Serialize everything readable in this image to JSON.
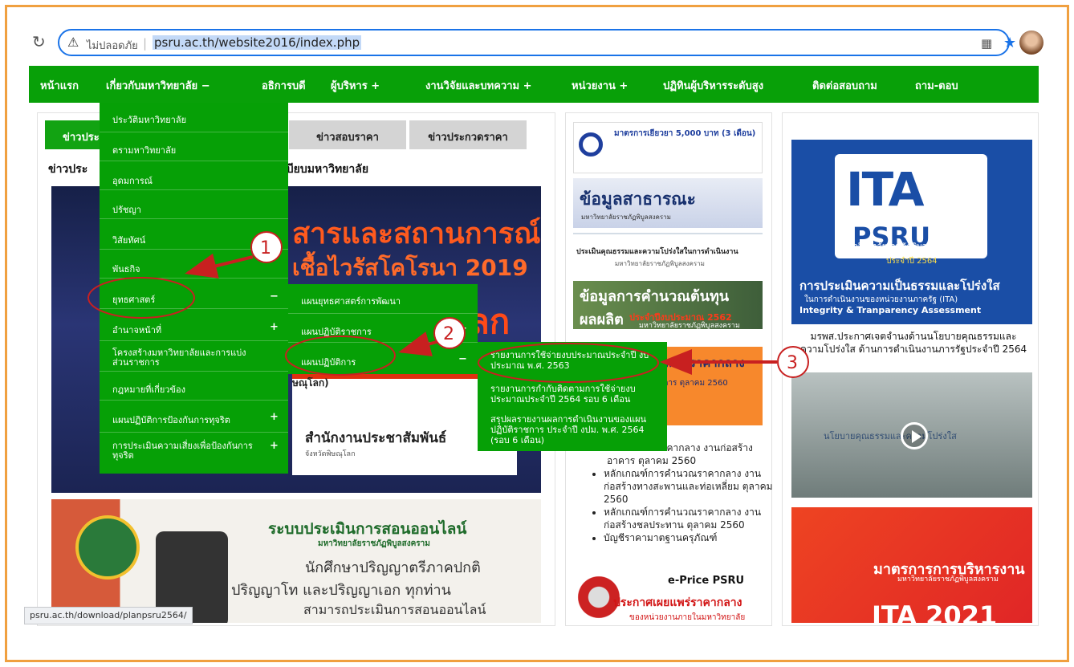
{
  "browser": {
    "not_secure": "ไม่ปลอดภัย",
    "url": "psru.ac.th/website2016/index.php",
    "status_url": "psru.ac.th/download/planpsru2564/"
  },
  "nav": {
    "items": [
      {
        "label": "หน้าแรก"
      },
      {
        "label": "เกี่ยวกับมหาวิทยาลัย  −"
      },
      {
        "label": "อธิการบดี"
      },
      {
        "label": "ผู้บริหาร  +"
      },
      {
        "label": "งานวิจัยและบทความ  +"
      },
      {
        "label": "หน่วยงาน  +"
      },
      {
        "label": "ปฏิทินผู้บริหารระดับสูง"
      },
      {
        "label": "ติดต่อสอบถาม"
      },
      {
        "label": "ถาม-ตอบ"
      }
    ]
  },
  "tabs": {
    "active": "ข่าวประ",
    "t2": "ข่าวสอบราคา",
    "t3": "ข่าวประกวดราคา"
  },
  "news": {
    "heading_left": "ข่าวประ",
    "heading_right": "เบียบมหาวิทยาลัย"
  },
  "banner1": {
    "line1": "สารและสถานการณ์",
    "line2": "เชื้อไวรัสโคโรนา 2019",
    "line3": "ลก",
    "small": "ษณุโลก)",
    "office": "สำนักงานประชาสัมพันธ์",
    "office_sub": "จังหวัดพิษณุโลก"
  },
  "banner2": {
    "title": "ระบบประเมินการสอนออนไลน์",
    "sub": "มหาวิทยาลัยราชภัฏพิบูลสงคราม",
    "l1": "นักศึกษาปริญญาตรีภาคปกติ",
    "l2": "ปริญญาโท และปริญญาเอก ทุกท่าน",
    "l3": "สามารถประเมินการสอนออนไลน์"
  },
  "menu1": {
    "items": [
      {
        "label": "ประวัติมหาวิทยาลัย",
        "sign": ""
      },
      {
        "label": "ตรามหาวิทยาลัย",
        "sign": ""
      },
      {
        "label": "อุดมการณ์",
        "sign": ""
      },
      {
        "label": "ปรัชญา",
        "sign": ""
      },
      {
        "label": "วิสัยทัศน์",
        "sign": ""
      },
      {
        "label": "พันธกิจ",
        "sign": ""
      },
      {
        "label": "ยุทธศาสตร์",
        "sign": "−"
      },
      {
        "label": "อำนาจหน้าที่",
        "sign": "+"
      },
      {
        "label": "โครงสร้างมหาวิทยาลัยและการแบ่ง\nส่วนราชการ",
        "sign": ""
      },
      {
        "label": "กฎหมายที่เกี่ยวข้อง",
        "sign": ""
      },
      {
        "label": "แผนปฏิบัติการป้องกันการทุจริต",
        "sign": "+"
      },
      {
        "label": "การประเมินความเสี่ยงเพื่อป้องกันการ\nทุจริต",
        "sign": "+"
      }
    ]
  },
  "menu2": {
    "items": [
      {
        "label": "แผนยุทธศาสตร์การพัฒนา",
        "sign": ""
      },
      {
        "label": "แผนปฏิบัติราชการ",
        "sign": "+"
      },
      {
        "label": "แผนปฏิบัติการ",
        "sign": "−"
      }
    ]
  },
  "menu3": {
    "items": [
      {
        "label": "รายงานการใช้จ่ายงบประมาณประจำปี งบประมาณ พ.ศ. 2563"
      },
      {
        "label": "รายงานการกำกับติดตามการใช้จ่ายงบประมาณประจำปี 2564 รอบ 6 เดือน"
      },
      {
        "label": "สรุปผลรายงานผลการดำเนินงานของแผนปฏิบัติราชการ ประจำปี งปม. พ.ศ. 2564 (รอบ 6 เดือน)"
      }
    ]
  },
  "annotations": [
    "1",
    "2",
    "3"
  ],
  "middle": {
    "card1_title": "มาตรการเยียวยา 5,000 บาท (3 เดือน)",
    "card2_title": "ข้อมูลสาธารณะ",
    "card2_sub": "มหาวิทยาลัยราชภัฏพิบูลสงคราม",
    "card3_title": "ประเมินคุณธรรมและความโปร่งใสในการดำเนินงาน",
    "card3_sub": "มหาวิทยาลัยราชภัฏพิบูลสงคราม",
    "card4_title": "ข้อมูลการคำนวณต้นทุนผลผลิต",
    "card4_sub": "ประจำปีงบประมาณ 2562",
    "card4_sub2": "มหาวิทยาลัยราชภัฏพิบูลสงคราม",
    "card5_title": "ธรรมการราคากลาง",
    "card5_sub": "อบการ ตุลาคม 2560",
    "list": [
      "การคำนวณราคากลาง งานก่อสร้างอาคาร ตุลาคม 2560",
      "หลักเกณฑ์การคำนวณราคากลาง งานก่อสร้างทางสะพานและท่อเหลี่ยม ตุลาคม 2560",
      "หลักเกณฑ์การคำนวณราคากลาง งานก่อสร้างชลประทาน ตุลาคม 2560",
      "บัญชีราคามาตฐานครุภัณฑ์"
    ],
    "eprice_title": "e-Price PSRU",
    "eprice_sub": "ประกาศเผยแพร่ราคากลาง",
    "eprice_sub2": "ของหน่วยงานภายในมหาวิทยาลัย"
  },
  "right": {
    "ita_logo": "ITA",
    "ita_psru": "PSRU",
    "ita_sub": "มหาวิทยาลัยราชภัฏพิบูลสงคราม",
    "ita_year": "ประจำปี 2564",
    "ita_t1": "การประเมินความเป็นธรรมและโปร่งใส",
    "ita_t2": "ในการดำเนินงานของหน่วยงานภาครัฐ (ITA)",
    "ita_t3": "Integrity & Tranparency Assessment",
    "caption": "มรพส.ประกาศเจตจำนงด้านนโยบายคุณธรรมและความโปร่งใส ด้านการดำเนินงานภารรัฐประจำปี 2564",
    "video_text": "นโยบายคุณธรรมและความโปร่งใส",
    "mgmt_title": "มาตรการการบริหารงาน",
    "mgmt_sub": "มหาวิทยาลัยราชภัฏพิบูลสงคราม",
    "mgmt_year": "ITA 2021"
  },
  "colors": {
    "nav_green": "#08a008",
    "annotation_red": "#c82020",
    "frame_orange": "#f0a040"
  }
}
